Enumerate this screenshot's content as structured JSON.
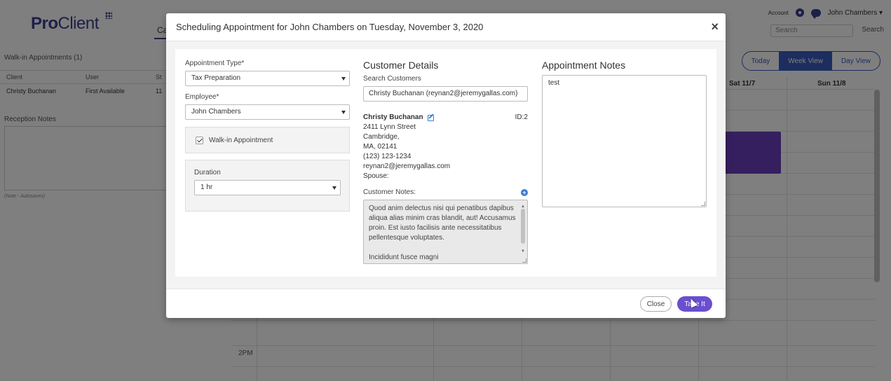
{
  "app": {
    "logo_pro": "Pro",
    "logo_client": "Client",
    "nav_tab": "Ca",
    "account": "Account",
    "user_menu": "John Chambers ▾",
    "search_placeholder": "Search",
    "search_button": "Search"
  },
  "walkin": {
    "title": "Walk-in Appointments (1)",
    "headers": [
      "Client",
      "User",
      "St"
    ],
    "row": [
      "Christy Buchanan",
      "First Available",
      "11"
    ]
  },
  "reception": {
    "title": "Reception Notes",
    "note": "(Note - Autosaves)"
  },
  "views": {
    "today": "Today",
    "week": "Week View",
    "day": "Day View"
  },
  "calendar": {
    "days": [
      "Sat 11/7",
      "Sun 11/8"
    ],
    "time_label": "2PM",
    "event_text": ""
  },
  "modal": {
    "title": "Scheduling Appointment for John Chambers on Tuesday, November 3, 2020",
    "close_icon": "×",
    "appointment_type_label": "Appointment Type*",
    "appointment_type_value": "Tax Preparation",
    "employee_label": "Employee*",
    "employee_value": "John Chambers",
    "walkin_label": "Walk-in Appointment",
    "duration_label": "Duration",
    "duration_value": "1 hr",
    "customer_details_title": "Customer Details",
    "search_customers_label": "Search Customers",
    "search_customers_value": "Christy Buchanan (reynan2@jeremygallas.com)",
    "customer": {
      "name": "Christy Buchanan",
      "id": "ID:2",
      "street": "2411 Lynn Street",
      "city": "Cambridge,",
      "state_zip": "MA, 02141",
      "phone": "(123) 123-1234",
      "email": "reynan2@jeremygallas.com",
      "spouse": "Spouse:"
    },
    "customer_notes_label": "Customer Notes:",
    "customer_notes_p1": "Quod anim delectus nisi qui penatibus dapibus aliqua alias minim cras blandit, aut! Accusamus proin. Est iusto facilisis ante necessitatibus pellentesque voluptates.",
    "customer_notes_p2": "Incididunt fusce magni",
    "appointment_notes_title": "Appointment Notes",
    "appointment_notes_value": "test",
    "close_button": "Close",
    "take_button": "Take It"
  }
}
